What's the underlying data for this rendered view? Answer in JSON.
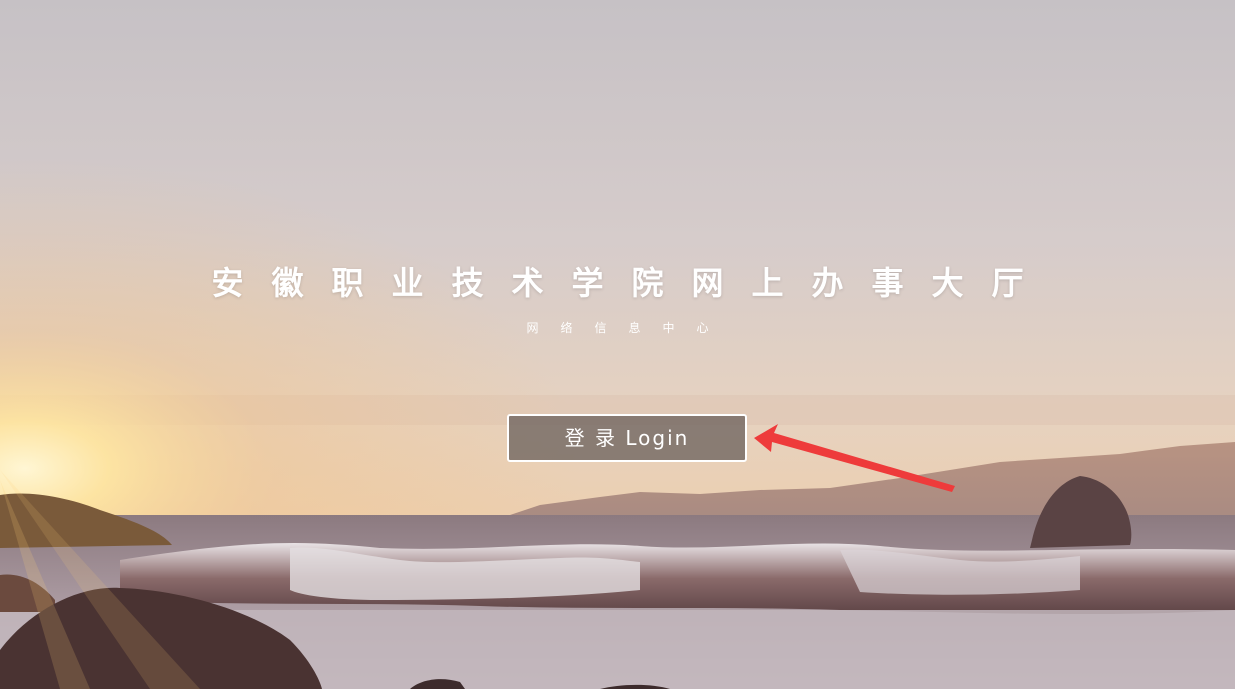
{
  "header": {
    "title": "安徽职业技术学院网上办事大厅",
    "subtitle": "网络信息中心"
  },
  "login": {
    "label": "登 录  Login"
  },
  "annotation": {
    "icon": "arrow-icon",
    "color": "#ee3b3b"
  },
  "colors": {
    "sky_top": "#c9c3c6",
    "horizon": "#e8c9a3",
    "sun": "#ffe9a8",
    "sea": "#6b5a5c"
  }
}
